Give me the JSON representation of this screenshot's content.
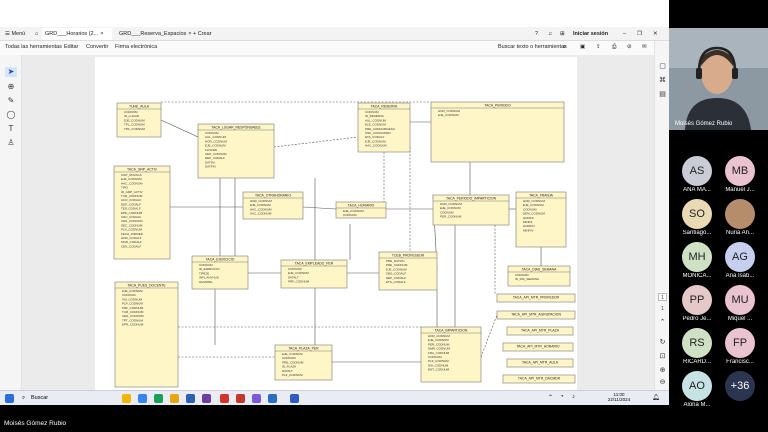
{
  "browser": {
    "menu_label": "Menú",
    "tabs": [
      "GRD___Horarios (2...",
      "GRD___Reserva_Espacios",
      "Crear"
    ],
    "signin": "Iniciar sesión"
  },
  "toolbar": {
    "items": [
      "Todas las herramientas",
      "Editar",
      "Convertir",
      "Firma electrónica"
    ],
    "search": "Buscar texto o herramientas"
  },
  "diagram": {
    "tables": [
      {
        "name": "TUHE_AULA",
        "attrs": [
          "CODNUM",
          "ID_LUGAR",
          "EJE_CODNUM",
          "TPL_CODNUM",
          "TPA_CODNUM"
        ]
      },
      {
        "name": "TACA_LUGAR_RESPONSABLE",
        "attrs": [
          "CODNUM",
          "AUL_CODNUM",
          "HOR_CODNUM",
          "EJE_CODNUM",
          "FLNCED",
          "CEN_CODNUM",
          "DEP_CODALF",
          "DATINI",
          "DATFIN"
        ]
      },
      {
        "name": "TACA_RESERVA",
        "attrs": [
          "CODNUM",
          "ID_RESERVA",
          "AUL_CODNUM",
          "ELE_CODNUM",
          "PRE_CODNUMGESO",
          "USU_CODNUMSO",
          "ETA_CODALF",
          "EJE_CODNUM",
          "HAC_CODNUM"
        ]
      },
      {
        "name": "TACA_PERIODO",
        "attrs": [
          "HOR_CODNUM",
          "EJE_CODNUM"
        ]
      },
      {
        "name": "TACA_GRP_ACTIV",
        "attrs": [
          "ASIT_RNVACA",
          "EJE_CODNUM",
          "HAC_CODNUM",
          "TIPO",
          "ID_GRP_ACTIV",
          "TUR_CODNUM",
          "ACO_CODALF",
          "DEP_CODALF",
          "TES_CODALF",
          "EPE_CODNUM",
          "CRC_CODALF",
          "CEN_CODNUM",
          "SEC_CODNUM",
          "PLN_CODNUM",
          "FECH_INIRVER",
          "HOR_CODALF",
          "MOD_CODALF",
          "CEN_CODALF"
        ]
      },
      {
        "name": "TACA_OTRAHORARIO",
        "attrs": [
          "HOR_CODNUM",
          "EJE_CODNUM",
          "HAC_CODNUM",
          "SAC_CODNUM"
        ]
      },
      {
        "name": "TACA_HORARIO",
        "attrs": [
          "EJE_CODNUM",
          "CODNUM"
        ]
      },
      {
        "name": "TACA_PERIODO_IMPARTICION",
        "attrs": [
          "HOR_CODNUM",
          "EJE_CODNUM",
          "CODNUM",
          "PER_CODNUM"
        ]
      },
      {
        "name": "TACA_FRANJA",
        "attrs": [
          "HOR_CODNUM",
          "EJE_CODNUM",
          "CODNUM",
          "DEM_CODNUM",
          "HORINI",
          "MININI",
          "HORFIN",
          "MINFIN"
        ]
      },
      {
        "name": "TACA_EJERCICIO",
        "attrs": [
          "CODNUM",
          "ID_EJERCICIO",
          "TIPEJE",
          "INFI_ANYHUS",
          "HUMORE"
        ]
      },
      {
        "name": "TACA_EMPLEADO_PER",
        "attrs": [
          "CODNUM",
          "EJE_CODNUM",
          "DATALT",
          "PRF_CODNUM"
        ]
      },
      {
        "name": "TCEB_PROFESSOR",
        "attrs": [
          "PRE_DATFIN",
          "PRE_CODNUM",
          "EJE_CODNUM",
          "OBS_CODALF",
          "DEP_CODALF",
          "ETS_CODALF"
        ]
      },
      {
        "name": "TACA_DIAS_SEMANA",
        "attrs": [
          "CODNUM",
          "ID_DIA_SEMANA"
        ]
      },
      {
        "name": "TACA_PUES_DOCENTE",
        "attrs": [
          "EJE_CODNUM",
          "CODNUM",
          "ASI_CODNUM",
          "PLP_CODNUM",
          "PRF_CODNUM",
          "TUR_CODNUM",
          "CEN_CODNUM",
          "TPT_CODNUM",
          "EPR_CODNUM"
        ]
      },
      {
        "name": "TACA_IMPARTICION",
        "attrs": [
          "HOR_CODNUM",
          "EJE_CODNUM",
          "PER_CODNUM",
          "DMR_CODNUM",
          "FRA_CODNUM",
          "CODNUM",
          "PLZ_CODNUM",
          "DIA_CODNUM",
          "ENT_CODNUM"
        ]
      },
      {
        "name": "TACA_PLAZA_PER",
        "attrs": [
          "EJE_CODNUM",
          "CODNUM",
          "PRE_CODNUM",
          "ID_PLAZA",
          "DATALT",
          "PLZ_CODNUM"
        ]
      },
      {
        "name": "TACA_API_MTR_PROFESOR",
        "attrs": []
      },
      {
        "name": "TACA_API_MTR_AGRUPACION",
        "attrs": []
      },
      {
        "name": "TACA_API_MTR_PLAZA",
        "attrs": []
      },
      {
        "name": "TACA_API_MTR_HORARIO",
        "attrs": []
      },
      {
        "name": "TACA_API_MTR_AULA",
        "attrs": []
      },
      {
        "name": "TACA_API_MTR_DACMDR",
        "attrs": []
      }
    ]
  },
  "pagination": {
    "current": "1",
    "total": "1"
  },
  "taskbar": {
    "search": "Buscar",
    "time": "11:00",
    "date": "22/11/2024"
  },
  "meeting": {
    "caption": "Moisés Gómez Rubio",
    "speaker_name": "Moisés Gómez Rubio",
    "participants": [
      {
        "initials": "AS",
        "name": "ANA MA...",
        "color": "#c9ccd4"
      },
      {
        "initials": "MB",
        "name": "Manuel J...",
        "color": "#e9c3cf"
      },
      {
        "initials": "SO",
        "name": "Santiago...",
        "color": "#ead9b5"
      },
      {
        "initials": "",
        "name": "Nuria An...",
        "color": "#b58d6c"
      },
      {
        "initials": "MH",
        "name": "MONICA...",
        "color": "#cfe1c5"
      },
      {
        "initials": "AG",
        "name": "Ana Isab...",
        "color": "#c6cff0"
      },
      {
        "initials": "PP",
        "name": "Pedro Je...",
        "color": "#e5c8c8"
      },
      {
        "initials": "MU",
        "name": "Miquel ...",
        "color": "#e9c3cf"
      },
      {
        "initials": "RS",
        "name": "RICARD...",
        "color": "#cfe1c5"
      },
      {
        "initials": "FP",
        "name": "Francisc...",
        "color": "#e9c3cf"
      },
      {
        "initials": "AO",
        "name": "Alona M...",
        "color": "#c6e2e5"
      },
      {
        "initials": "+36",
        "name": "",
        "color": "#2b3550"
      }
    ]
  }
}
